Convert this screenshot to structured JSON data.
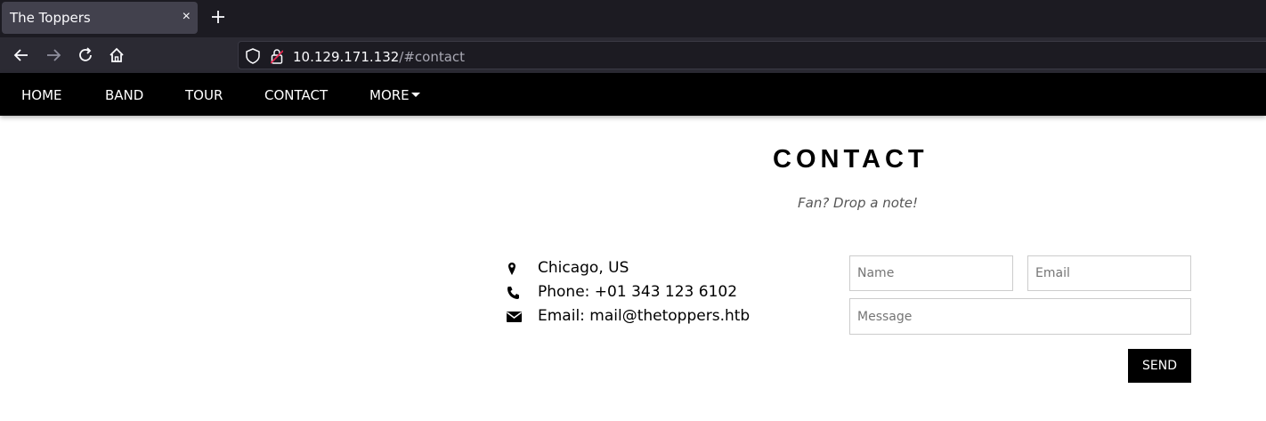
{
  "browser": {
    "tab_title": "The Toppers",
    "tab_close": "×",
    "url_host": "10.129.171.132",
    "url_path": "/#contact"
  },
  "site_nav": {
    "items": [
      "HOME",
      "BAND",
      "TOUR",
      "CONTACT",
      "MORE"
    ]
  },
  "contact": {
    "title": "CONTACT",
    "subtitle": "Fan? Drop a note!",
    "info": {
      "location": "Chicago, US",
      "phone": "Phone: +01 343 123 6102",
      "email": "Email: mail@thetoppers.htb"
    },
    "form": {
      "name_placeholder": "Name",
      "email_placeholder": "Email",
      "message_placeholder": "Message",
      "send_label": "SEND"
    }
  },
  "colors": {
    "tab_bg": "#42414d",
    "chrome_bg": "#1c1b22",
    "toolbar_bg": "#2b2a33",
    "site_nav_bg": "#000000",
    "accent": "#000000"
  }
}
